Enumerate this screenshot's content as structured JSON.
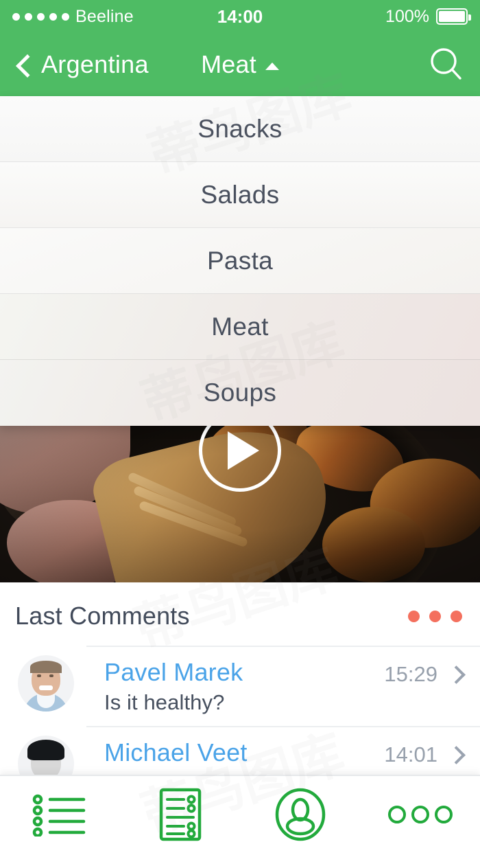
{
  "status_bar": {
    "carrier": "Beeline",
    "signal_dots": 5,
    "time": "14:00",
    "battery_percent": "100%",
    "battery_icon": "battery-full-icon"
  },
  "nav_bar": {
    "back_label": "Argentina",
    "back_icon": "chevron-left-icon",
    "title": "Meat",
    "title_caret_icon": "caret-up-icon",
    "search_icon": "search-icon",
    "background_color": "#4EBC64"
  },
  "dropdown": {
    "open": true,
    "selected": "Meat",
    "items": [
      {
        "label": "Snacks"
      },
      {
        "label": "Salads"
      },
      {
        "label": "Pasta"
      },
      {
        "label": "Meat"
      },
      {
        "label": "Soups"
      }
    ]
  },
  "hero": {
    "play_icon": "play-button-icon",
    "alt": "roasted meat in a pan with wooden fork"
  },
  "comments_section": {
    "title": "Last Comments",
    "more_icon": "more-dots-icon",
    "more_color": "#F4705E",
    "items": [
      {
        "avatar_icon": "user-avatar",
        "name": "Pavel Marek",
        "text": "Is it healthy?",
        "time": "15:29",
        "chevron_icon": "chevron-right-icon"
      },
      {
        "avatar_icon": "user-avatar",
        "name": "Michael Veet",
        "text": "",
        "time": "14:01",
        "chevron_icon": "chevron-right-icon"
      }
    ]
  },
  "tab_bar": {
    "accent_color": "#22AA3C",
    "tabs": [
      {
        "icon": "bulleted-list-icon",
        "label": ""
      },
      {
        "icon": "document-list-icon",
        "label": ""
      },
      {
        "icon": "user-circle-icon",
        "label": ""
      },
      {
        "icon": "more-circles-icon",
        "label": ""
      }
    ]
  },
  "watermark": {
    "text": "蒂鸟图库"
  }
}
